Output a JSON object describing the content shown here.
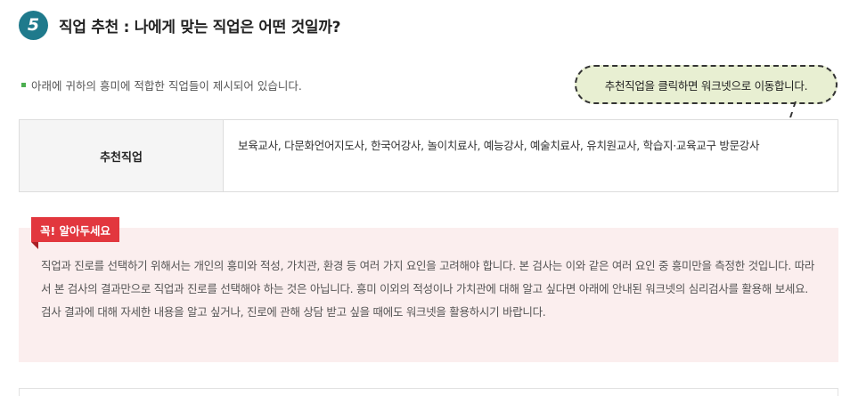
{
  "section": {
    "number": "5",
    "title": "직업 추천 : 나에게 맞는 직업은 어떤 것일까?"
  },
  "intro_text": "아래에 귀하의 흥미에 적합한 직업들이 제시되어 있습니다.",
  "bubble_text": "추천직업을 클릭하면 워크넷으로 이동합니다.",
  "job_table": {
    "header": "추천직업",
    "jobs": "보육교사, 다문화언어지도사, 한국어강사, 놀이치료사, 예능강사, 예술치료사, 유치원교사, 학습지·교육교구 방문강사"
  },
  "notice": {
    "tag": "꼭! 알아두세요",
    "body": "직업과 진로를 선택하기 위해서는 개인의 흥미와 적성, 가치관, 환경 등 여러 가지 요인을 고려해야 합니다. 본 검사는 이와 같은 여러 요인 중 흥미만을 측정한 것입니다. 따라서 본 검사의 결과만으로 직업과 진로를 선택해야 하는 것은 아닙니다. 흥미 이외의 적성이나 가치관에 대해 알고 싶다면 아래에 안내된 워크넷의 심리검사를 활용해 보세요. 검사 결과에 대해 자세한 내용을 알고 싶거나, 진로에 관해 상담 받고 싶을 때에도 워크넷을 활용하시기 바랍니다."
  },
  "colors": {
    "section_badge": "#1f7a8c",
    "bullet": "#4caf50",
    "bubble_bg": "#e8efd2",
    "notice_tag": "#e2373e",
    "notice_bg": "#fbeeee"
  }
}
